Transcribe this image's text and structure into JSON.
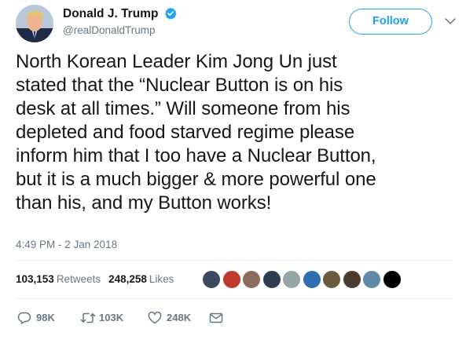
{
  "user": {
    "display_name": "Donald J. Trump",
    "handle": "@realDonaldTrump",
    "verified": true,
    "follow_label": "Follow"
  },
  "tweet": {
    "text": "North Korean Leader Kim Jong Un just\nstated that the “Nuclear Button is on his\ndesk at all times.” Will someone from his\ndepleted and food starved regime please\ninform him that I too have a Nuclear Button,\nbut it is a much bigger & more powerful one\nthan his, and my Button works!",
    "timestamp": "4:49 PM - 2 Jan 2018"
  },
  "stats": {
    "retweets_count": "103,153",
    "retweets_label": "Retweets",
    "likes_count": "248,258",
    "likes_label": "Likes"
  },
  "liker_avatars": [
    {
      "color": "#3b4a5c"
    },
    {
      "color": "#c0392b"
    },
    {
      "color": "#8a6d5a"
    },
    {
      "color": "#2c3e50"
    },
    {
      "color": "#95a5a6"
    },
    {
      "color": "#2f6fb0"
    },
    {
      "color": "#6b5b3e"
    },
    {
      "color": "#4a3b2e"
    },
    {
      "color": "#5d8aa8"
    },
    {
      "color": "#000000"
    }
  ],
  "actions": {
    "replies": "98K",
    "retweets": "103K",
    "likes": "248K"
  },
  "colors": {
    "accent": "#1da1f2",
    "text": "#14171a",
    "secondary": "#657786"
  }
}
